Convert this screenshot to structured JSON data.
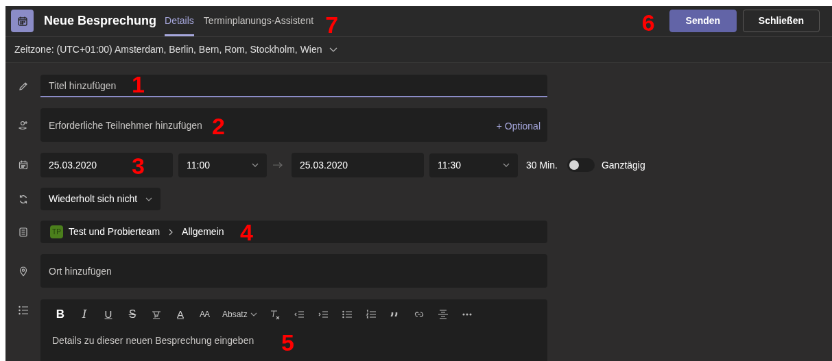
{
  "header": {
    "title": "Neue Besprechung",
    "tabs": [
      {
        "label": "Details",
        "selected": true
      },
      {
        "label": "Terminplanungs-Assistent",
        "selected": false
      }
    ],
    "buttons": [
      {
        "label": "Senden",
        "kind": "primary"
      },
      {
        "label": "Schließen",
        "kind": "secondary"
      }
    ]
  },
  "timezone": {
    "label": "Zeitzone: (UTC+01:00) Amsterdam, Berlin, Bern, Rom, Stockholm, Wien"
  },
  "title_field": {
    "placeholder": "Titel hinzufügen"
  },
  "attendees": {
    "placeholder": "Erforderliche Teilnehmer hinzufügen",
    "optional_link": "+ Optional"
  },
  "schedule": {
    "start_date": "25.03.2020",
    "start_time": "11:00",
    "end_date": "25.03.2020",
    "end_time": "11:30",
    "duration": "30 Min.",
    "all_day": {
      "label": "Ganztägig",
      "on": false
    }
  },
  "repeat": {
    "value": "Wiederholt sich nicht"
  },
  "channel": {
    "team_initials": "TP",
    "team": "Test und Probierteam",
    "channel": "Allgemein"
  },
  "location": {
    "placeholder": "Ort hinzufügen"
  },
  "editor": {
    "toolbar": [
      {
        "kind": "bold",
        "label": "B"
      },
      {
        "kind": "italic",
        "label": "I"
      },
      {
        "kind": "underline",
        "label": "U"
      },
      {
        "kind": "strike",
        "label": "S"
      },
      {
        "kind": "highlight"
      },
      {
        "kind": "fontcolor",
        "label": "A"
      },
      {
        "kind": "fontsize",
        "label": "AA"
      },
      {
        "kind": "dropdown",
        "label": "Absatz"
      },
      {
        "kind": "clear"
      },
      {
        "kind": "outdent"
      },
      {
        "kind": "indent"
      },
      {
        "kind": "bullets"
      },
      {
        "kind": "numbers"
      },
      {
        "kind": "quote"
      },
      {
        "kind": "link"
      },
      {
        "kind": "rule"
      },
      {
        "kind": "more"
      }
    ],
    "placeholder": "Details zu dieser neuen Besprechung eingeben"
  },
  "callouts": {
    "title": "1",
    "attendees": "2",
    "date": "3",
    "channel": "4",
    "editor": "5",
    "buttons": "6",
    "tabs": "7"
  }
}
